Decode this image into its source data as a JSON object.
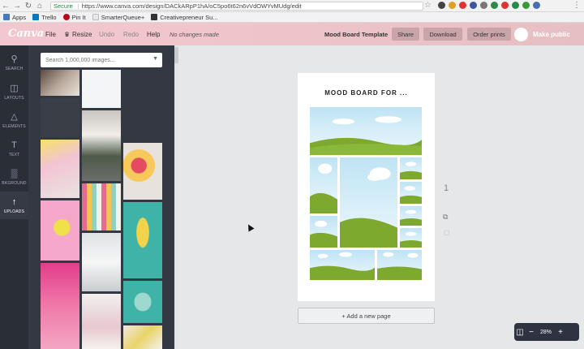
{
  "browser": {
    "url_secure": "Secure",
    "url": "https://www.canva.com/design/DACkARpP1hA/oC5po6t62n6vVdOWYvMUdg/edit",
    "bookmarks": [
      "Apps",
      "Trello",
      "Pin It",
      "SmarterQueue+",
      "Creativepreneur Su..."
    ]
  },
  "header": {
    "logo": "Canva",
    "menu": [
      "File",
      "Resize",
      "Undo",
      "Redo",
      "Help"
    ],
    "status": "No changes made",
    "doc_title": "Mood Board Template",
    "buttons": [
      "Share",
      "Download",
      "Order prints"
    ],
    "make_public": "Make public"
  },
  "sidebar": {
    "items": [
      {
        "label": "SEARCH",
        "icon": "search-icon"
      },
      {
        "label": "LAYOUTS",
        "icon": "layouts-icon"
      },
      {
        "label": "ELEMENTS",
        "icon": "elements-icon"
      },
      {
        "label": "TEXT",
        "icon": "text-icon"
      },
      {
        "label": "BKGROUND",
        "icon": "background-icon"
      },
      {
        "label": "UPLOADS",
        "icon": "upload-icon"
      }
    ],
    "active": "UPLOADS"
  },
  "panel": {
    "search_placeholder": "Search 1,000,000 images..."
  },
  "canvas": {
    "page_title": "MOOD  BOARD FOR ...",
    "page_number": "1",
    "add_page": "+ Add a new page",
    "zoom": "28%"
  },
  "colors": {
    "header_pink": "#eec4c9",
    "sidebar_dark": "#2a2e37",
    "panel_dark": "#343842",
    "hill_green": "#7da92e",
    "sky_blue": "#bfe3f4"
  }
}
